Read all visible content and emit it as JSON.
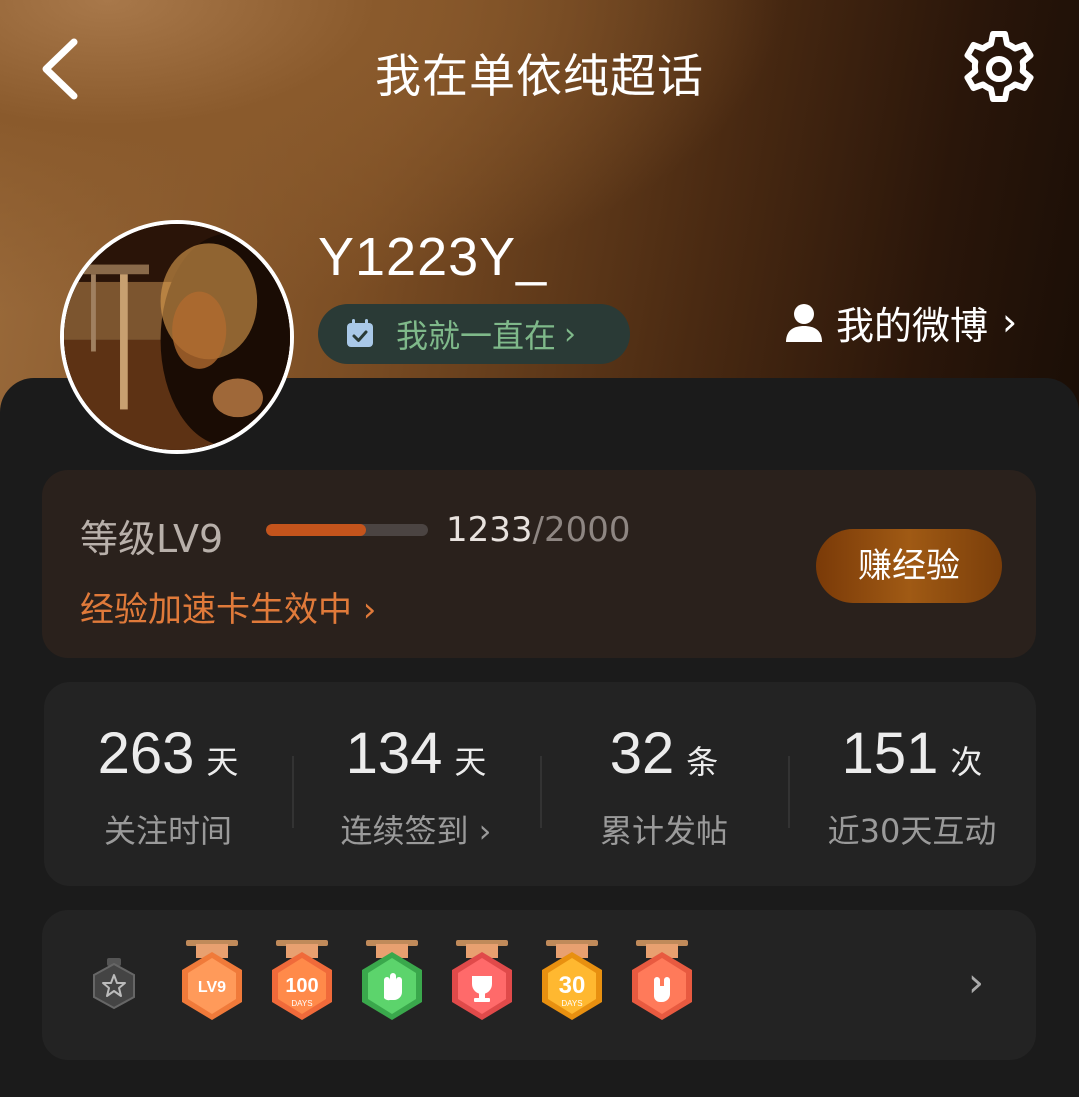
{
  "header": {
    "title": "我在单依纯超话",
    "back_icon": "chevron-left-icon",
    "settings_icon": "gear-icon"
  },
  "profile": {
    "username": "Y1223Y_",
    "status_pill": {
      "label": "我就一直在",
      "chevron": "›",
      "icon": "calendar-check-icon"
    },
    "my_weibo": {
      "label": "我的微博",
      "chevron": "›",
      "icon": "user-icon"
    }
  },
  "level": {
    "label": "等级LV9",
    "xp_current": "1233",
    "xp_total": "/2000",
    "progress": 0.62,
    "boost_text": "经验加速卡生效中 ›",
    "earn_button": "赚经验"
  },
  "stats": [
    {
      "num": "263",
      "unit": "天",
      "caption": "关注时间"
    },
    {
      "num": "134",
      "unit": "天",
      "caption": "连续签到 ›"
    },
    {
      "num": "32",
      "unit": "条",
      "caption": "累计发帖"
    },
    {
      "num": "151",
      "unit": "次",
      "caption": "近30天互动"
    }
  ],
  "badges": {
    "items": [
      {
        "name": "lv9-badge-icon",
        "text": "LV9",
        "color": "#f07a3a"
      },
      {
        "name": "100-days-badge-icon",
        "text": "100",
        "color": "#f06a3a"
      },
      {
        "name": "hand-badge-icon",
        "text": "",
        "color": "#4cc45c"
      },
      {
        "name": "trophy-badge-icon",
        "text": "",
        "color": "#f05a5a"
      },
      {
        "name": "30-days-badge-icon",
        "text": "30",
        "color": "#f0a020"
      },
      {
        "name": "rock-hand-badge-icon",
        "text": "",
        "color": "#f06a4a"
      }
    ],
    "chevron": "›"
  },
  "colors": {
    "accent_orange": "#e07a3a",
    "pill_green": "#7fb98a",
    "xp_fill": "#c4541c"
  }
}
